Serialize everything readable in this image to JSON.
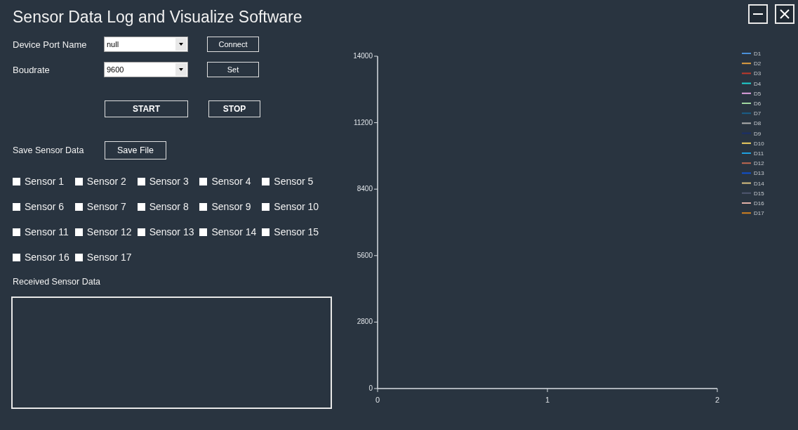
{
  "window": {
    "title": "Sensor Data Log and Visualize Software",
    "buttons": [
      {
        "kind": "minimize"
      },
      {
        "kind": "close"
      }
    ]
  },
  "port": {
    "label": "Device Port Name",
    "value": "null",
    "button": "Connect"
  },
  "baud": {
    "label": "Boudrate",
    "value": "9600",
    "button": "Set"
  },
  "controls": {
    "start": "START",
    "stop": "STOP"
  },
  "save": {
    "label": "Save Sensor Data",
    "button": "Save File"
  },
  "sensors": [
    {
      "label": "Sensor 1",
      "checked": false
    },
    {
      "label": "Sensor 2",
      "checked": false
    },
    {
      "label": "Sensor 3",
      "checked": false
    },
    {
      "label": "Sensor 4",
      "checked": false
    },
    {
      "label": "Sensor 5",
      "checked": false
    },
    {
      "label": "Sensor 6",
      "checked": false
    },
    {
      "label": "Sensor 7",
      "checked": false
    },
    {
      "label": "Sensor 8",
      "checked": false
    },
    {
      "label": "Sensor 9",
      "checked": false
    },
    {
      "label": "Sensor 10",
      "checked": false
    },
    {
      "label": "Sensor 11",
      "checked": false
    },
    {
      "label": "Sensor 12",
      "checked": false
    },
    {
      "label": "Sensor 13",
      "checked": false
    },
    {
      "label": "Sensor 14",
      "checked": false
    },
    {
      "label": "Sensor 15",
      "checked": false
    },
    {
      "label": "Sensor 16",
      "checked": false
    },
    {
      "label": "Sensor 17",
      "checked": false
    }
  ],
  "received": {
    "label": "Received Sensor Data"
  },
  "chart": {
    "chart_data": {
      "type": "line",
      "categories": [
        "0",
        "1",
        "2"
      ],
      "ylim": [
        0,
        14000
      ],
      "yticks": [
        0,
        2800,
        5600,
        8400,
        11200,
        14000
      ],
      "series": [
        {
          "name": "D1",
          "color": "#4a90d9",
          "values": [
            null,
            null,
            null
          ]
        },
        {
          "name": "D2",
          "color": "#e0a040",
          "values": [
            null,
            null,
            null
          ]
        },
        {
          "name": "D3",
          "color": "#c0392b",
          "values": [
            null,
            null,
            null
          ]
        },
        {
          "name": "D4",
          "color": "#1fd1d1",
          "values": [
            null,
            null,
            null
          ]
        },
        {
          "name": "D5",
          "color": "#e0a0e0",
          "values": [
            null,
            null,
            null
          ]
        },
        {
          "name": "D6",
          "color": "#a0d8a0",
          "values": [
            null,
            null,
            null
          ]
        },
        {
          "name": "D7",
          "color": "#1a5f8a",
          "values": [
            null,
            null,
            null
          ]
        },
        {
          "name": "D8",
          "color": "#b0b0b0",
          "values": [
            null,
            null,
            null
          ]
        },
        {
          "name": "D9",
          "color": "#1a2f6a",
          "values": [
            null,
            null,
            null
          ]
        },
        {
          "name": "D10",
          "color": "#f0d060",
          "values": [
            null,
            null,
            null
          ]
        },
        {
          "name": "D11",
          "color": "#1ea0e0",
          "values": [
            null,
            null,
            null
          ]
        },
        {
          "name": "D12",
          "color": "#c06850",
          "values": [
            null,
            null,
            null
          ]
        },
        {
          "name": "D13",
          "color": "#1050d0",
          "values": [
            null,
            null,
            null
          ]
        },
        {
          "name": "D14",
          "color": "#d8c080",
          "values": [
            null,
            null,
            null
          ]
        },
        {
          "name": "D15",
          "color": "#505870",
          "values": [
            null,
            null,
            null
          ]
        },
        {
          "name": "D16",
          "color": "#e0b0a8",
          "values": [
            null,
            null,
            null
          ]
        },
        {
          "name": "D17",
          "color": "#d08020",
          "values": [
            null,
            null,
            null
          ]
        }
      ]
    }
  }
}
